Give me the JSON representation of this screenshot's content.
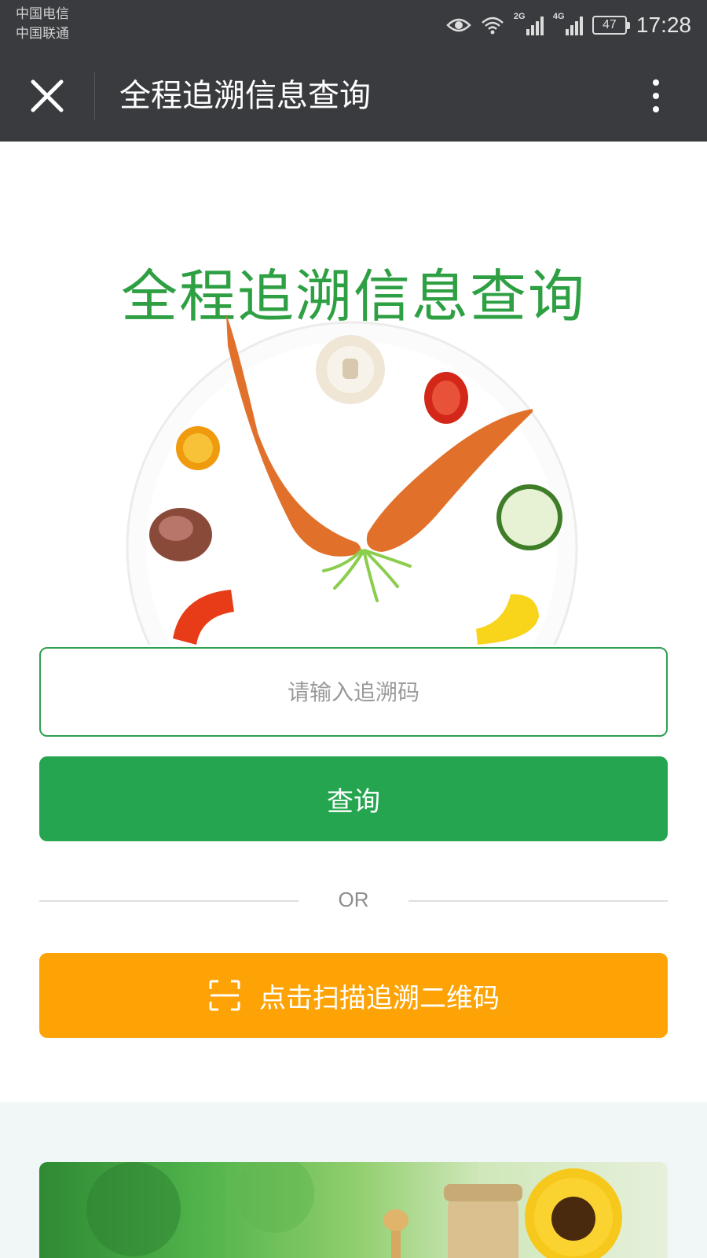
{
  "status_bar": {
    "carrier_1": "中国电信",
    "carrier_2": "中国联通",
    "network_2g": "2G",
    "network_4g": "4G",
    "battery": "47",
    "time": "17:28"
  },
  "nav": {
    "title": "全程追溯信息查询"
  },
  "hero": {
    "title": "全程追溯信息查询"
  },
  "form": {
    "input_placeholder": "请输入追溯码",
    "query_label": "查询",
    "or_label": "OR",
    "scan_label": "点击扫描追溯二维码"
  },
  "colors": {
    "nav_background": "#3a3b3f",
    "primary_green": "#25a54f",
    "scan_orange": "#fda305",
    "bottom_background": "#f1f6f6"
  }
}
